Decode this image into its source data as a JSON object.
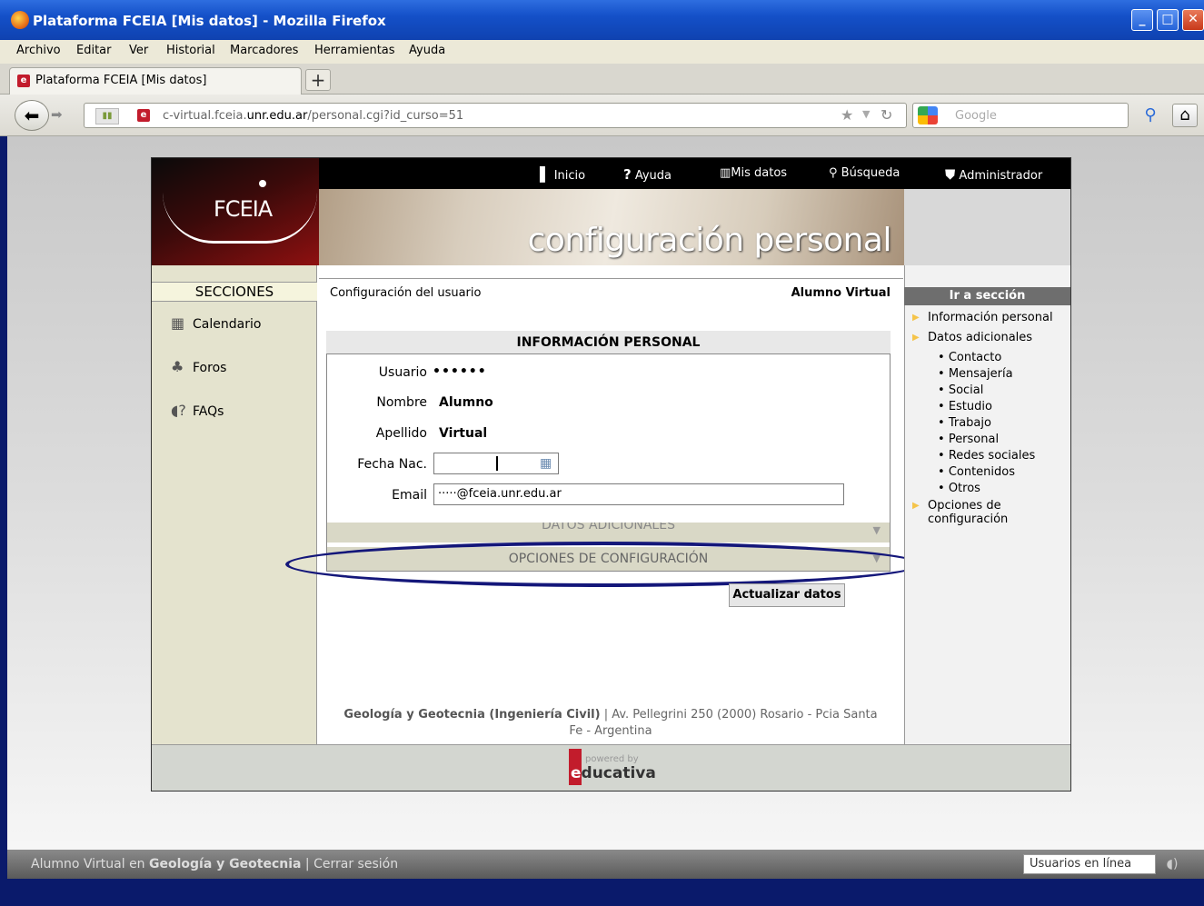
{
  "window": {
    "title": "Plataforma FCEIA [Mis datos] - Mozilla Firefox",
    "buttons": {
      "minimize": "_",
      "maximize": "□",
      "close": "✕"
    }
  },
  "menubar": [
    "Archivo",
    "Editar",
    "Ver",
    "Historial",
    "Marcadores",
    "Herramientas",
    "Ayuda"
  ],
  "tab": {
    "title": "Plataforma FCEIA [Mis datos]",
    "new_tab": "+"
  },
  "navbar": {
    "url_host_prefix": "c-virtual.fceia.",
    "url_domain": "unr.edu.ar",
    "url_path": "/personal.cgi?id_curso=51",
    "search_placeholder": "Google"
  },
  "site": {
    "logo_text": "FCEIA",
    "banner_title": "configuración personal",
    "top_nav": [
      {
        "label": "Inicio",
        "icon": "door-icon"
      },
      {
        "label": "Ayuda",
        "icon": "question-icon"
      },
      {
        "label": "Mis datos",
        "icon": "file-icon"
      },
      {
        "label": "Búsqueda",
        "icon": "magnifier-icon"
      },
      {
        "label": "Administrador",
        "icon": "shield-icon"
      }
    ]
  },
  "sidebar": {
    "header": "SECCIONES",
    "items": [
      {
        "label": "Calendario",
        "icon": "calendar-icon"
      },
      {
        "label": "Foros",
        "icon": "forum-icon"
      },
      {
        "label": "FAQs",
        "icon": "faq-icon"
      }
    ]
  },
  "main": {
    "config_label": "Configuración del usuario",
    "user_name": "Alumno Virtual",
    "panel_title": "INFORMACIÓN PERSONAL",
    "fields": {
      "usuario_label": "Usuario",
      "usuario_value": "••••••",
      "nombre_label": "Nombre",
      "nombre_value": "Alumno",
      "apellido_label": "Apellido",
      "apellido_value": "Virtual",
      "fecha_label": "Fecha Nac.",
      "fecha_value": "",
      "email_label": "Email",
      "email_value": "·····@fceia.unr.edu.ar"
    },
    "datos_adicionales": "DATOS ADICIONALES",
    "opciones_configuracion": "OPCIONES DE CONFIGURACIÓN",
    "update_button": "Actualizar datos",
    "footer_bold": "Geología y Geotecnia (Ingeniería Civil)",
    "footer_rest": " | Av. Pellegrini 250 (2000) Rosario - Pcia Santa Fe - Argentina"
  },
  "right": {
    "header": "Ir a sección",
    "links": [
      "Información personal",
      "Datos adicionales"
    ],
    "sublinks": [
      "Contacto",
      "Mensajería",
      "Social",
      "Estudio",
      "Trabajo",
      "Personal",
      "Redes sociales",
      "Contenidos",
      "Otros"
    ],
    "last_link_1": "Opciones de",
    "last_link_2": "configuración"
  },
  "powered": {
    "line1": "powered by",
    "brand_e": "e",
    "brand_rest": "ducativa"
  },
  "statusbar": {
    "prefix": "Alumno Virtual en ",
    "course": "Geología y Geotecnia",
    "sep": " | ",
    "logout": "Cerrar sesión",
    "online_users": "Usuarios en línea"
  },
  "colors": {
    "accent_red": "#8e1010",
    "ellipse": "#14177a",
    "arrow": "#f5c44a"
  }
}
